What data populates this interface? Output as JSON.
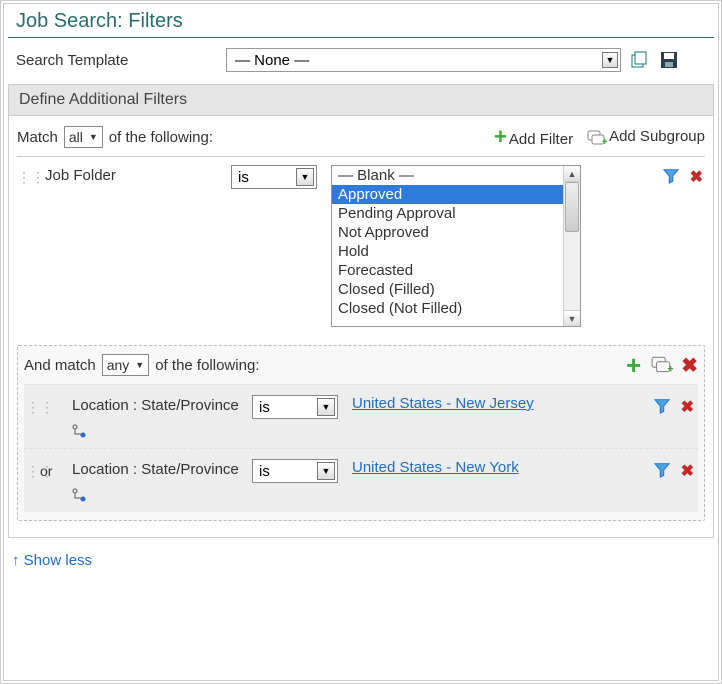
{
  "title": "Job Search: Filters",
  "template": {
    "label": "Search Template",
    "value": "— None —"
  },
  "section_heading": "Define Additional Filters",
  "match": {
    "prefix": "Match",
    "mode": "all",
    "suffix": "of the following:",
    "add_filter": "Add Filter",
    "add_subgroup": "Add Subgroup"
  },
  "filter1": {
    "field": "Job Folder",
    "operator": "is",
    "options": [
      "— Blank —",
      "Approved",
      "Pending Approval",
      "Not Approved",
      "Hold",
      "Forecasted",
      "Closed (Filled)",
      "Closed (Not Filled)"
    ],
    "selected": "Approved"
  },
  "subgroup": {
    "prefix": "And match",
    "mode": "any",
    "suffix": "of the following:",
    "rows": [
      {
        "conj": "",
        "field": "Location : State/Province",
        "operator": "is",
        "value": "United States - New Jersey"
      },
      {
        "conj": "or",
        "field": "Location : State/Province",
        "operator": "is",
        "value": "United States - New York"
      }
    ]
  },
  "show_less": "Show less"
}
